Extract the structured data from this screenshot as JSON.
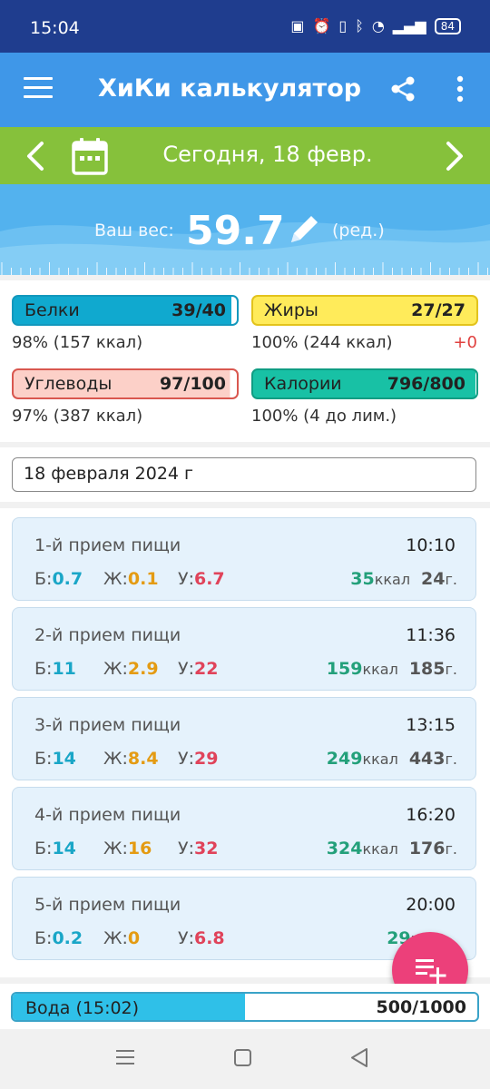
{
  "status": {
    "time": "15:04",
    "battery": "84"
  },
  "app": {
    "title": "ХиКи калькулятор..."
  },
  "date_nav": {
    "label": "Сегодня, 18 февр."
  },
  "weight": {
    "label": "Ваш вес:",
    "value": "59.7",
    "edit_label": "(ред.)"
  },
  "macros": {
    "protein": {
      "label": "Белки",
      "value": "39/40",
      "sub": "98% (157 ккал)",
      "fraction": 0.975,
      "color": "#10a9cf",
      "border": "#1398bd"
    },
    "fat": {
      "label": "Жиры",
      "value": "27/27",
      "sub": "100% (244 ккал)",
      "delta": "+0",
      "fraction": 1.0,
      "color": "#ffeb5a",
      "border": "#e3c31c"
    },
    "carbs": {
      "label": "Углеводы",
      "value": "97/100",
      "sub": "97% (387 ккал)",
      "fraction": 0.97,
      "color": "#fcd0c8",
      "border": "#d9574f"
    },
    "calories": {
      "label": "Калории",
      "value": "796/800",
      "sub": "100% (4 до лим.)",
      "fraction": 0.995,
      "color": "#18c1a5",
      "border": "#0f9d83"
    }
  },
  "date_field": {
    "value": "18 февраля 2024 г"
  },
  "nutrient_labels": {
    "protein": "Б:",
    "fat": "Ж:",
    "carbs": "У:",
    "kcal_unit": "ккал",
    "gram_unit": "г."
  },
  "meals": [
    {
      "name": "1-й прием пищи",
      "time": "10:10",
      "protein": "0.7",
      "fat": "0.1",
      "carbs": "6.7",
      "kcal": "35",
      "grams": "24"
    },
    {
      "name": "2-й прием пищи",
      "time": "11:36",
      "protein": "11",
      "fat": "2.9",
      "carbs": "22",
      "kcal": "159",
      "grams": "185"
    },
    {
      "name": "3-й прием пищи",
      "time": "13:15",
      "protein": "14",
      "fat": "8.4",
      "carbs": "29",
      "kcal": "249",
      "grams": "443"
    },
    {
      "name": "4-й прием пищи",
      "time": "16:20",
      "protein": "14",
      "fat": "16",
      "carbs": "32",
      "kcal": "324",
      "grams": "176"
    },
    {
      "name": "5-й прием пищи",
      "time": "20:00",
      "protein": "0.2",
      "fat": "0",
      "carbs": "6.8",
      "kcal": "29",
      "grams": ""
    }
  ],
  "water": {
    "label": "Вода (15:02)",
    "value": "500/1000",
    "fraction": 0.5
  },
  "colors": {
    "status_bar": "#1f3d8e",
    "app_bar": "#3f97e8",
    "date_bar": "#86c13b",
    "weight_bg": "#53b2ee",
    "fab": "#ec407a",
    "water_fill": "#2fc0e8"
  },
  "icons": {
    "menu": "hamburger-menu-icon",
    "share": "share-icon",
    "more": "more-vert-icon",
    "prev": "chevron-left-icon",
    "next": "chevron-right-icon",
    "calendar": "calendar-icon",
    "edit_weight": "pencil-icon",
    "add_meal": "playlist-add-icon"
  }
}
